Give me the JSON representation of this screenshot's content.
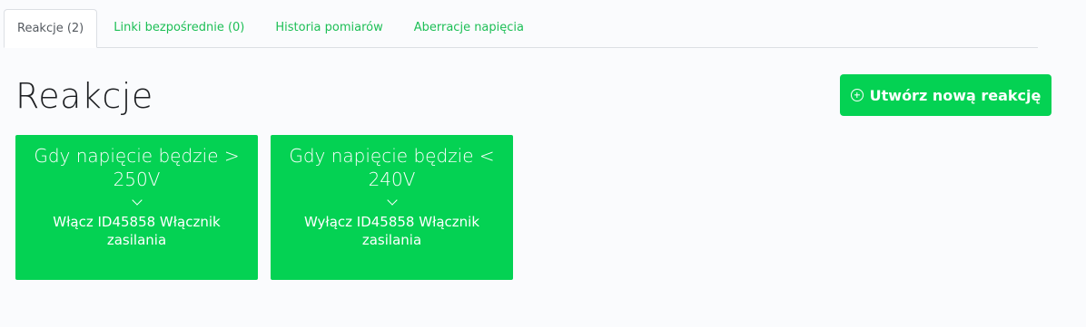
{
  "tabs": [
    {
      "label": "Reakcje (2)",
      "active": true
    },
    {
      "label": "Linki bezpośrednie (0)",
      "active": false
    },
    {
      "label": "Historia pomiarów",
      "active": false
    },
    {
      "label": "Aberracje napięcia",
      "active": false
    }
  ],
  "page": {
    "title": "Reakcje",
    "create_button_label": "Utwórz nową reakcję",
    "create_button_icon": "plus-circle-icon"
  },
  "reactions": [
    {
      "condition": "Gdy napięcie będzie > 250V",
      "action": "Włącz ID45858 Włącznik zasilania"
    },
    {
      "condition": "Gdy napięcie będzie < 240V",
      "action": "Wyłącz ID45858 Włącznik zasilania"
    }
  ],
  "colors": {
    "accent": "#04d253",
    "tab_link": "#1dbf56",
    "background": "#fafbfd",
    "title": "#1d1f22"
  }
}
